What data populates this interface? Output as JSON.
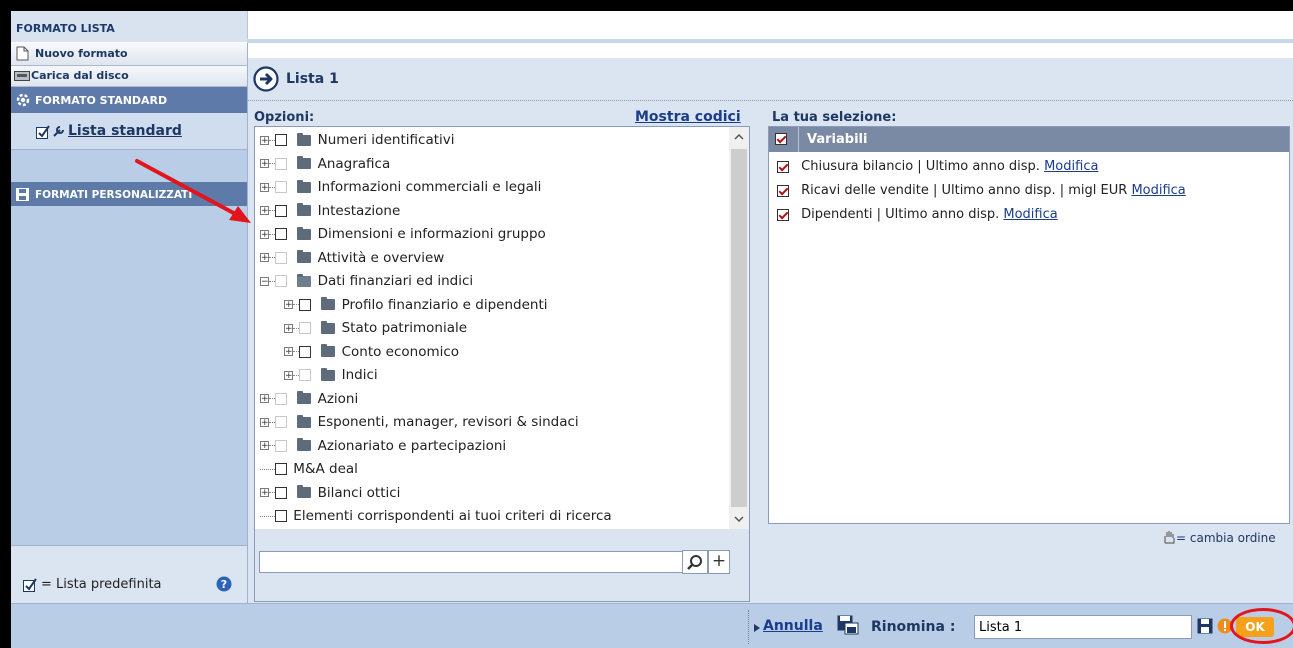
{
  "window": {
    "title": "FORMATO LISTA"
  },
  "sidebar": {
    "new_format": "Nuovo formato",
    "load_disk": "Carica dal disco",
    "standard_header": "FORMATO STANDARD",
    "standard_item": "Lista standard",
    "custom_header": "FORMATI PERSONALIZZATI",
    "legend": "= Lista predefinita"
  },
  "list": {
    "title": "Lista 1"
  },
  "options": {
    "label": "Opzioni:",
    "show_codes": "Mostra codici",
    "tree": [
      {
        "label": "Numeri identificativi",
        "level": 0,
        "expander": "+",
        "enabled": true
      },
      {
        "label": "Anagrafica",
        "level": 0,
        "expander": "+",
        "enabled": false
      },
      {
        "label": "Informazioni commerciali e legali",
        "level": 0,
        "expander": "+",
        "enabled": false
      },
      {
        "label": "Intestazione",
        "level": 0,
        "expander": "+",
        "enabled": true
      },
      {
        "label": "Dimensioni e informazioni gruppo",
        "level": 0,
        "expander": "+",
        "enabled": true
      },
      {
        "label": "Attività e overview",
        "level": 0,
        "expander": "+",
        "enabled": false
      },
      {
        "label": "Dati finanziari ed indici",
        "level": 0,
        "expander": "-",
        "enabled": false,
        "open": true
      },
      {
        "label": "Profilo finanziario e dipendenti",
        "level": 1,
        "expander": "+",
        "enabled": true
      },
      {
        "label": "Stato patrimoniale",
        "level": 1,
        "expander": "+",
        "enabled": false
      },
      {
        "label": "Conto economico",
        "level": 1,
        "expander": "+",
        "enabled": true
      },
      {
        "label": "Indici",
        "level": 1,
        "expander": "+",
        "enabled": false
      },
      {
        "label": "Azioni",
        "level": 0,
        "expander": "+",
        "enabled": false
      },
      {
        "label": "Esponenti, manager, revisori & sindaci",
        "level": 0,
        "expander": "+",
        "enabled": false
      },
      {
        "label": "Azionariato e partecipazioni",
        "level": 0,
        "expander": "+",
        "enabled": false
      },
      {
        "label": "M&A deal",
        "level": 0,
        "expander": "",
        "enabled": true,
        "nofolder": true
      },
      {
        "label": "Bilanci ottici",
        "level": 0,
        "expander": "+",
        "enabled": true
      },
      {
        "label": "Elementi corrispondenti ai tuoi criteri di ricerca",
        "level": 0,
        "expander": "",
        "enabled": true,
        "nofolder": true
      }
    ],
    "search_value": ""
  },
  "selection": {
    "label": "La tua selezione:",
    "header": "Variabili",
    "modify_label": "Modifica",
    "items": [
      "Chiusura bilancio | Ultimo anno disp.",
      "Ricavi delle vendite | Ultimo anno disp. | migl EUR",
      "Dipendenti | Ultimo anno disp."
    ],
    "reorder_hint": "= cambia ordine"
  },
  "footer": {
    "cancel": "Annulla",
    "rename_label": "Rinomina :",
    "rename_value": "Lista 1",
    "ok": "OK"
  },
  "colors": {
    "accent_red": "#e3141b",
    "ok_orange": "#f5a11c",
    "link": "#1a3c8c"
  }
}
